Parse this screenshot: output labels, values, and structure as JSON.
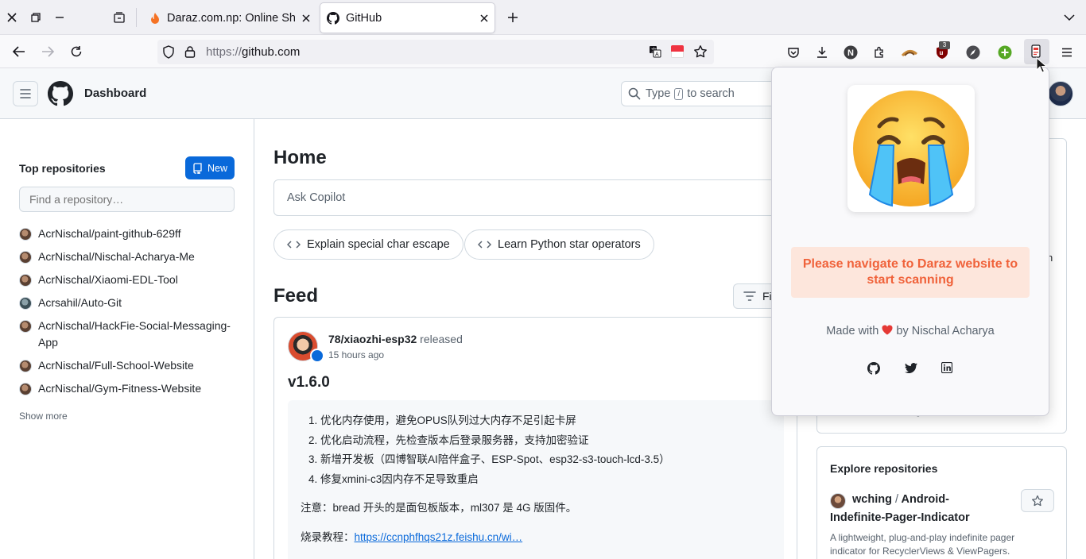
{
  "browser": {
    "tabs": [
      {
        "label": "Daraz.com.np: Online Sho"
      },
      {
        "label": "GitHub"
      }
    ],
    "url": {
      "scheme": "https://",
      "host": "github.com"
    },
    "extension_badge": "3"
  },
  "header": {
    "title": "Dashboard",
    "search": {
      "prefix": "Type",
      "key": "/",
      "suffix": "to search"
    }
  },
  "sidebar": {
    "heading": "Top repositories",
    "new_label": "New",
    "find_placeholder": "Find a repository…",
    "repos": [
      "AcrNischal/paint-github-629ff",
      "AcrNischal/Nischal-Acharya-Me",
      "AcrNischal/Xiaomi-EDL-Tool",
      "Acrsahil/Auto-Git",
      "AcrNischal/HackFie-Social-Messaging-App",
      "AcrNischal/Full-School-Website",
      "AcrNischal/Gym-Fitness-Website"
    ],
    "show_more": "Show more"
  },
  "main": {
    "home_title": "Home",
    "copilot_placeholder": "Ask Copilot",
    "suggestions": [
      "Explain special char escape",
      "Learn Python star operators"
    ],
    "feed_title": "Feed",
    "filter_label": "Fi",
    "feed_item": {
      "repo": "78/xiaozhi-esp32",
      "action": "released",
      "time": "15 hours ago",
      "version": "v1.6.0",
      "notes": [
        "优化内存使用，避免OPUS队列过大内存不足引起卡屏",
        "优化启动流程，先检查版本后登录服务器，支持加密验证",
        "新增开发板（四博智联AI陪伴盒子、ESP-Spot、esp32-s3-touch-lcd-3.5）",
        "修复xmini-c3因内存不足导致重启"
      ],
      "note_numbers": [
        "1.",
        "2.",
        "3.",
        "4."
      ],
      "notice": "注意：bread 开头的是面包板版本，ml307 是 4G 版固件。",
      "tutorial_label": "烧录教程：",
      "tutorial_link": "https://ccnphfhqs21z.feishu.cn/wi…"
    }
  },
  "right": {
    "side_fragment": "n",
    "bottom_fragment": "g",
    "explore_title": "Explore repositories",
    "explore_repo": {
      "owner": "wching",
      "sep": "/",
      "name": "Android-Indefinite-Pager-Indicator",
      "description": "A lightweight, plug-and-play indefinite pager indicator for RecyclerViews & ViewPagers."
    }
  },
  "popup": {
    "message": "Please navigate to Daraz website to start scanning",
    "made_prefix": "Made with",
    "made_suffix": "by Nischal Acharya",
    "heart_color": "#e53935",
    "message_bg": "#fde6dc",
    "message_color": "#f0623a",
    "social_icons": [
      "github-icon",
      "twitter-icon",
      "linkedin-icon"
    ]
  },
  "colors": {
    "primary_button": "#0969da",
    "link": "#0969da"
  }
}
